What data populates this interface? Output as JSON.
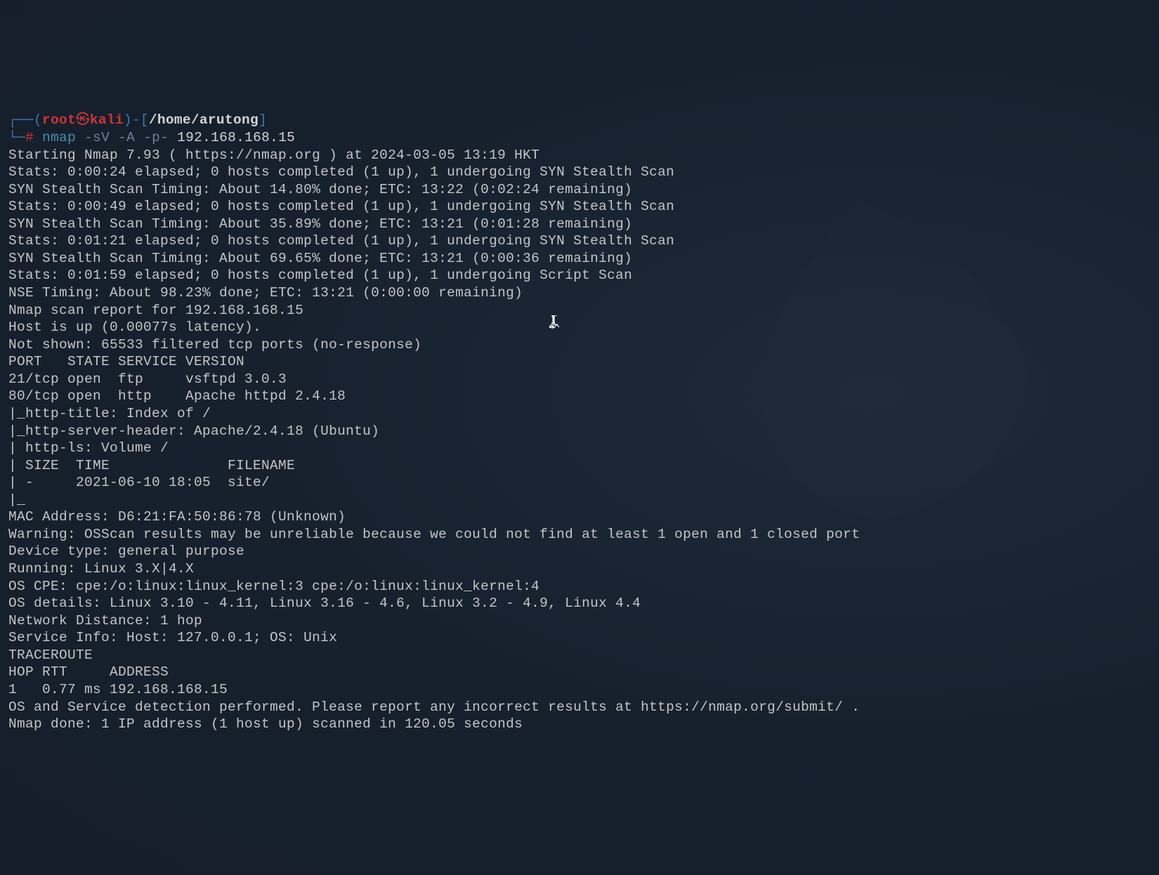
{
  "prompt": {
    "user": "root",
    "hostname": "kali",
    "path": "/home/arutong",
    "symbol": "#"
  },
  "command": {
    "name": "nmap",
    "flags": "-sV -A -p-",
    "target": "192.168.168.15"
  },
  "output": {
    "lines": [
      "Starting Nmap 7.93 ( https://nmap.org ) at 2024-03-05 13:19 HKT",
      "Stats: 0:00:24 elapsed; 0 hosts completed (1 up), 1 undergoing SYN Stealth Scan",
      "SYN Stealth Scan Timing: About 14.80% done; ETC: 13:22 (0:02:24 remaining)",
      "Stats: 0:00:49 elapsed; 0 hosts completed (1 up), 1 undergoing SYN Stealth Scan",
      "SYN Stealth Scan Timing: About 35.89% done; ETC: 13:21 (0:01:28 remaining)",
      "Stats: 0:01:21 elapsed; 0 hosts completed (1 up), 1 undergoing SYN Stealth Scan",
      "SYN Stealth Scan Timing: About 69.65% done; ETC: 13:21 (0:00:36 remaining)",
      "Stats: 0:01:59 elapsed; 0 hosts completed (1 up), 1 undergoing Script Scan",
      "NSE Timing: About 98.23% done; ETC: 13:21 (0:00:00 remaining)",
      "Nmap scan report for 192.168.168.15",
      "Host is up (0.00077s latency).",
      "Not shown: 65533 filtered tcp ports (no-response)",
      "PORT   STATE SERVICE VERSION",
      "21/tcp open  ftp     vsftpd 3.0.3",
      "80/tcp open  http    Apache httpd 2.4.18",
      "|_http-title: Index of /",
      "|_http-server-header: Apache/2.4.18 (Ubuntu)",
      "| http-ls: Volume /",
      "| SIZE  TIME              FILENAME",
      "| -     2021-06-10 18:05  site/",
      "|_",
      "MAC Address: D6:21:FA:50:86:78 (Unknown)",
      "Warning: OSScan results may be unreliable because we could not find at least 1 open and 1 closed port",
      "Device type: general purpose",
      "Running: Linux 3.X|4.X",
      "OS CPE: cpe:/o:linux:linux_kernel:3 cpe:/o:linux:linux_kernel:4",
      "OS details: Linux 3.10 - 4.11, Linux 3.16 - 4.6, Linux 3.2 - 4.9, Linux 4.4",
      "Network Distance: 1 hop",
      "Service Info: Host: 127.0.0.1; OS: Unix",
      "",
      "TRACEROUTE",
      "HOP RTT     ADDRESS",
      "1   0.77 ms 192.168.168.15",
      "",
      "OS and Service detection performed. Please report any incorrect results at https://nmap.org/submit/ .",
      "Nmap done: 1 IP address (1 host up) scanned in 120.05 seconds"
    ]
  }
}
